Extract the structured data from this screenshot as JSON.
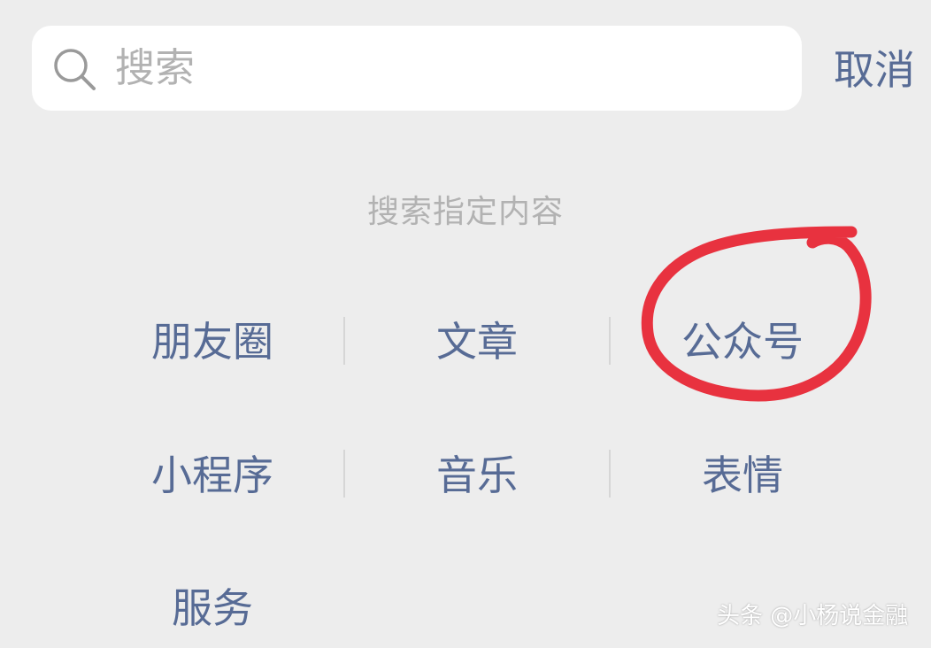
{
  "search": {
    "placeholder": "搜索",
    "value": "",
    "icon": "search-icon"
  },
  "cancel_label": "取消",
  "section_title": "搜索指定内容",
  "options": [
    {
      "label": "朋友圈"
    },
    {
      "label": "文章"
    },
    {
      "label": "公众号"
    },
    {
      "label": "小程序"
    },
    {
      "label": "音乐"
    },
    {
      "label": "表情"
    },
    {
      "label": "服务"
    }
  ],
  "watermark": "头条 @小杨说金融",
  "colors": {
    "background": "#ededed",
    "link": "#576b95",
    "muted": "#b2b2b2",
    "annotation_red": "#e8323f"
  }
}
